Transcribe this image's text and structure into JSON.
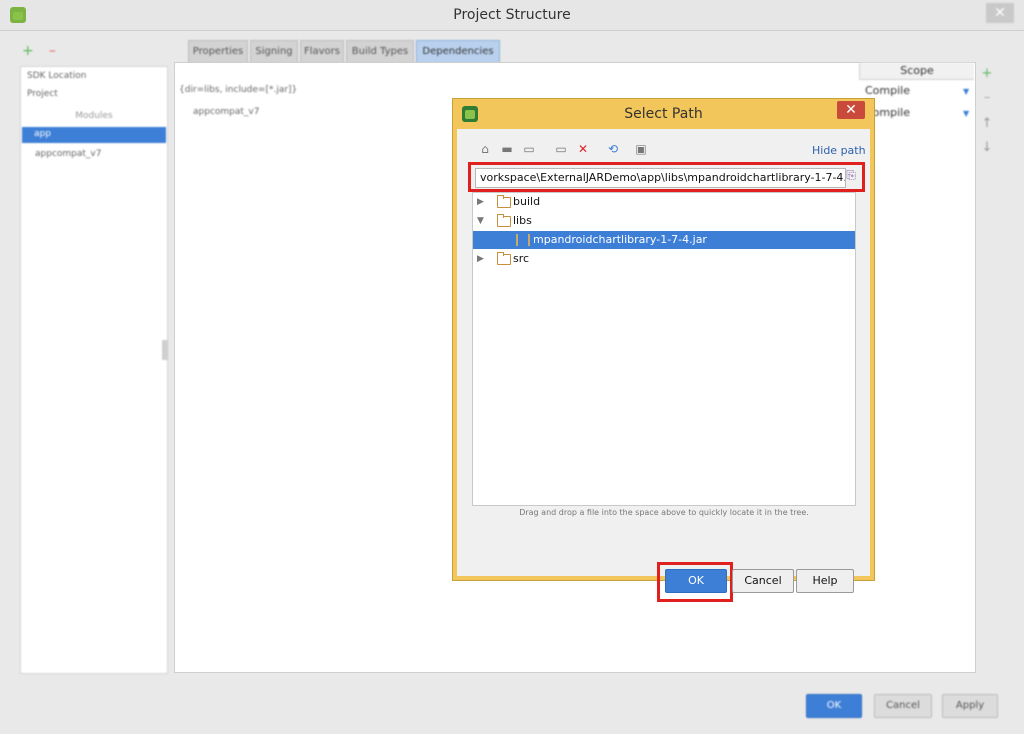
{
  "window": {
    "title": "Project Structure",
    "close_glyph": "✕"
  },
  "sidebar": {
    "items": [
      "SDK Location",
      "Project"
    ],
    "modules_header": "Modules",
    "modules": [
      "app",
      "appcompat_v7"
    ]
  },
  "tabs": [
    "Properties",
    "Signing",
    "Flavors",
    "Build Types",
    "Dependencies"
  ],
  "dependencies": {
    "scope_header": "Scope",
    "rows": [
      {
        "name": "{dir=libs, include=[*.jar]}",
        "scope": "Compile"
      },
      {
        "name": "appcompat_v7",
        "scope": "Compile"
      }
    ]
  },
  "footer": {
    "ok": "OK",
    "cancel": "Cancel",
    "apply": "Apply"
  },
  "dialog": {
    "title": "Select Path",
    "close_glyph": "✕",
    "hide_path": "Hide path",
    "path_value": "vorkspace\\ExternalJARDemo\\app\\libs\\mpandroidchartlibrary-1-7-4.jar",
    "tree": [
      {
        "label": "build",
        "type": "folder",
        "expanded": false
      },
      {
        "label": "libs",
        "type": "folder",
        "expanded": true
      },
      {
        "label": "mpandroidchartlibrary-1-7-4.jar",
        "type": "jar",
        "selected": true
      },
      {
        "label": "src",
        "type": "folder",
        "expanded": false
      }
    ],
    "hint": "Drag and drop a file into the space above to quickly locate it in the tree.",
    "ok": "OK",
    "cancel": "Cancel",
    "help": "Help"
  },
  "colors": {
    "accent": "#3d7fd6",
    "highlight_outline": "#e0201f",
    "dialog_frame": "#f2c65a"
  },
  "icons": [
    "home-icon",
    "desktop-icon",
    "folder-icon",
    "new-folder-icon",
    "delete-icon",
    "refresh-icon",
    "show-hidden-icon",
    "history-icon"
  ]
}
